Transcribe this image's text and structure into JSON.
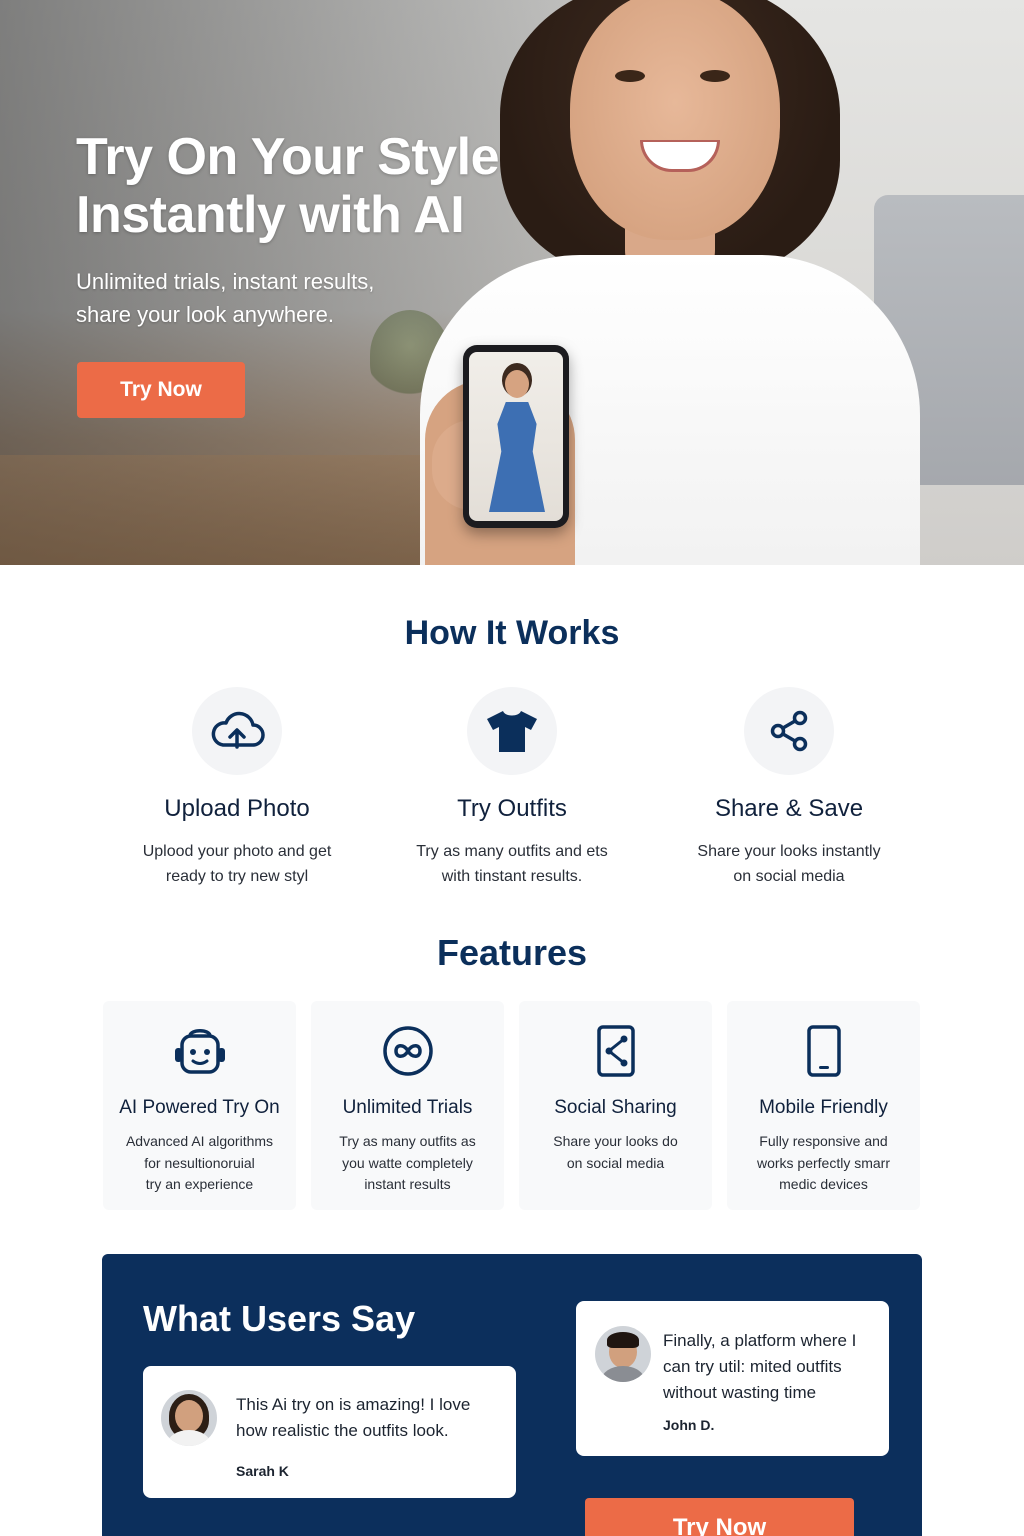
{
  "hero": {
    "title_line1": "Try On Your Style",
    "title_line2": "Instantly with AI",
    "subtitle_line1": "Unlimited trials, instant results,",
    "subtitle_line2": "share your look anywhere.",
    "cta_label": "Try Now"
  },
  "how_it_works": {
    "title": "How It Works",
    "steps": [
      {
        "icon": "cloud-upload-icon",
        "title": "Upload Photo",
        "line1": "Uplood your photo and get",
        "line2": "ready to try new styl"
      },
      {
        "icon": "tshirt-icon",
        "title": "Try Outfits",
        "line1": "Try as many outfits and ets",
        "line2": "with tinstant results."
      },
      {
        "icon": "share-icon",
        "title": "Share & Save",
        "line1": "Share your looks instantly",
        "line2": "on social media"
      }
    ]
  },
  "features": {
    "title": "Features",
    "items": [
      {
        "icon": "robot-icon",
        "title": "AI Powered Try On",
        "line1": "Advanced AI algorithms",
        "line2": "for nesultionoruial",
        "line3": "try an experience"
      },
      {
        "icon": "infinity-icon",
        "title": "Unlimited Trials",
        "line1": "Try as many outfits as",
        "line2": "you watte completely",
        "line3": "instant results"
      },
      {
        "icon": "phone-share-icon",
        "title": "Social Sharing",
        "line1": "Share your looks do",
        "line2": "on social media",
        "line3": ""
      },
      {
        "icon": "mobile-icon",
        "title": "Mobile Friendly",
        "line1": "Fully responsive and",
        "line2": "works perfectly smarr",
        "line3": "medic devices"
      }
    ]
  },
  "testimonials": {
    "title": "What Users Say",
    "items": [
      {
        "line1": "This Ai try on is amazing! I love",
        "line2": "how realistic the outfits look.",
        "line3": "",
        "author": "Sarah K"
      },
      {
        "line1": "Finally, a platform where I",
        "line2": "can try util: mited outfits",
        "line3": "without wasting time",
        "author": "John D."
      }
    ],
    "cta_label": "Try Now"
  },
  "colors": {
    "accent": "#ec6b47",
    "navy": "#0c2f5c",
    "heading": "#0b2f5b"
  }
}
